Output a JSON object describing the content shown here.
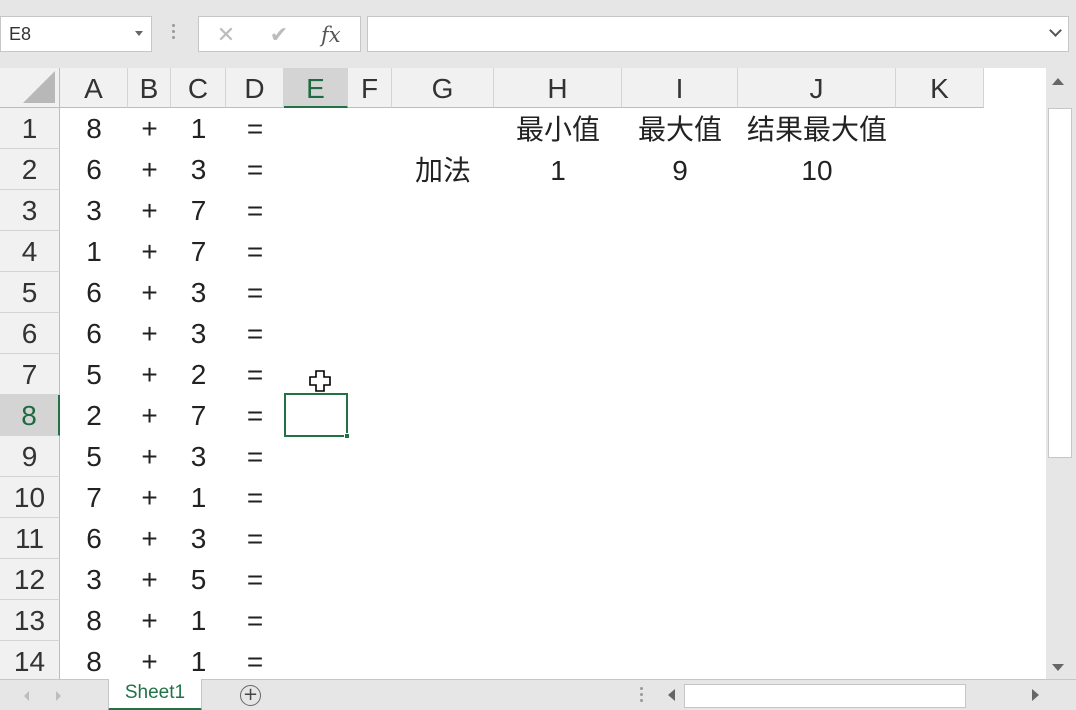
{
  "formula_bar": {
    "name_box": "E8",
    "cancel_glyph": "✕",
    "enter_glyph": "✔",
    "fx_label": "fx",
    "formula": ""
  },
  "columns": [
    "A",
    "B",
    "C",
    "D",
    "E",
    "F",
    "G",
    "H",
    "I",
    "J",
    "K"
  ],
  "active_column": "E",
  "rows": [
    "1",
    "2",
    "3",
    "4",
    "5",
    "6",
    "7",
    "8",
    "9",
    "10",
    "11",
    "12",
    "13",
    "14"
  ],
  "active_row": "8",
  "equations": [
    {
      "a": "8",
      "op": "+",
      "c": "1",
      "eq": "="
    },
    {
      "a": "6",
      "op": "+",
      "c": "3",
      "eq": "="
    },
    {
      "a": "3",
      "op": "+",
      "c": "7",
      "eq": "="
    },
    {
      "a": "1",
      "op": "+",
      "c": "7",
      "eq": "="
    },
    {
      "a": "6",
      "op": "+",
      "c": "3",
      "eq": "="
    },
    {
      "a": "6",
      "op": "+",
      "c": "3",
      "eq": "="
    },
    {
      "a": "5",
      "op": "+",
      "c": "2",
      "eq": "="
    },
    {
      "a": "2",
      "op": "+",
      "c": "7",
      "eq": "="
    },
    {
      "a": "5",
      "op": "+",
      "c": "3",
      "eq": "="
    },
    {
      "a": "7",
      "op": "+",
      "c": "1",
      "eq": "="
    },
    {
      "a": "6",
      "op": "+",
      "c": "3",
      "eq": "="
    },
    {
      "a": "3",
      "op": "+",
      "c": "5",
      "eq": "="
    },
    {
      "a": "8",
      "op": "+",
      "c": "1",
      "eq": "="
    },
    {
      "a": "8",
      "op": "+",
      "c": "1",
      "eq": "="
    }
  ],
  "settings_table": {
    "header_min": "最小值",
    "header_max": "最大值",
    "header_result_max": "结果最大值",
    "row_label": "加法",
    "min": "1",
    "max": "9",
    "result_max": "10"
  },
  "selected_cell": "E8",
  "sheet_tab": "Sheet1",
  "add_sheet_glyph": "+",
  "colors": {
    "accent": "#217346",
    "header_bg": "#f1f1f1",
    "grid_line": "#d4d4d4"
  },
  "icons": [
    "dropdown-arrow-icon",
    "cancel-icon",
    "enter-check-icon",
    "fx-icon",
    "expand-chevron-icon",
    "select-all-triangle-icon",
    "cross-cursor-icon",
    "scroll-up-icon",
    "scroll-down-icon",
    "scroll-left-icon",
    "scroll-right-icon",
    "add-sheet-icon"
  ]
}
